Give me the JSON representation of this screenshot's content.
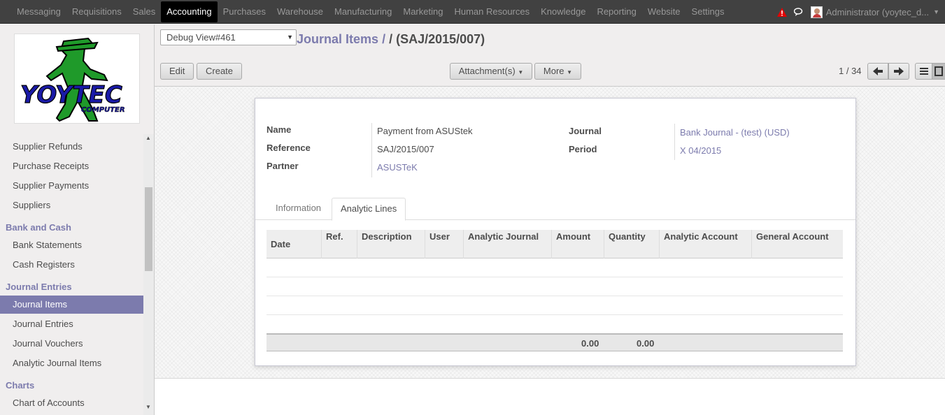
{
  "topnav": {
    "items": [
      "Messaging",
      "Requisitions",
      "Sales",
      "Accounting",
      "Purchases",
      "Warehouse",
      "Manufacturing",
      "Marketing",
      "Human Resources",
      "Knowledge",
      "Reporting",
      "Website",
      "Settings"
    ],
    "active": "Accounting",
    "user": "Administrator (yoytec_d..."
  },
  "sidebar": {
    "logo_text": "YOYTEC",
    "logo_sub": "COMPUTER",
    "items": {
      "supplier_refunds": "Supplier Refunds",
      "purchase_receipts": "Purchase Receipts",
      "supplier_payments": "Supplier Payments",
      "suppliers": "Suppliers",
      "bank_cash_head": "Bank and Cash",
      "bank_statements": "Bank Statements",
      "cash_registers": "Cash Registers",
      "journal_entries_head": "Journal Entries",
      "journal_items": "Journal Items",
      "journal_entries": "Journal Entries",
      "journal_vouchers": "Journal Vouchers",
      "analytic_journal_items": "Analytic Journal Items",
      "charts_head": "Charts",
      "chart_of_accounts": "Chart of Accounts"
    }
  },
  "control": {
    "debug_select": "Debug View#461",
    "breadcrumb_link": "Journal Items",
    "breadcrumb_sep": "/",
    "breadcrumb_current": "/ (SAJ/2015/007)",
    "edit_label": "Edit",
    "create_label": "Create",
    "attachments_label": "Attachment(s)",
    "more_label": "More",
    "pager": "1 / 34"
  },
  "form": {
    "name_label": "Name",
    "name_value": "Payment from ASUStek",
    "reference_label": "Reference",
    "reference_value": "SAJ/2015/007",
    "partner_label": "Partner",
    "partner_value": "ASUSTeK",
    "journal_label": "Journal",
    "journal_value": "Bank Journal - (test) (USD)",
    "period_label": "Period",
    "period_value": "X 04/2015"
  },
  "tabs": {
    "information": "Information",
    "analytic_lines": "Analytic Lines"
  },
  "grid": {
    "columns": [
      "Date",
      "Ref.",
      "Description",
      "User",
      "Analytic Journal",
      "Amount",
      "Quantity",
      "Analytic Account",
      "General Account"
    ],
    "totals": {
      "amount": "0.00",
      "quantity": "0.00"
    }
  },
  "colors": {
    "topbar": "#414141",
    "accent": "#7c7bad",
    "sidebar_bg": "#f0eeee"
  }
}
